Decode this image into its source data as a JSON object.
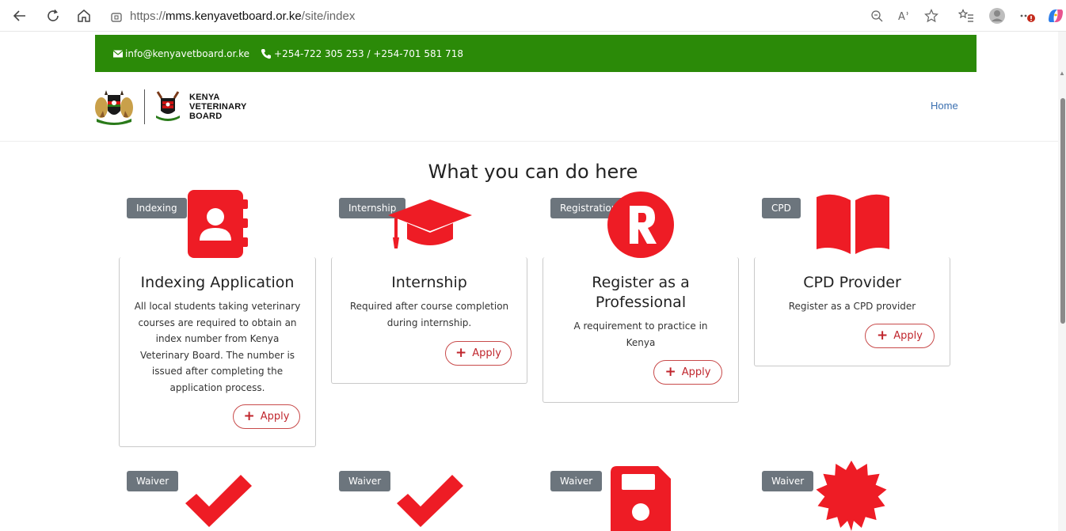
{
  "browser": {
    "url_proto": "https://",
    "url_host": "mms.kenyavetboard.or.ke",
    "url_path": "/site/index"
  },
  "contact": {
    "email": "info@kenyavetboard.or.ke",
    "phone": "+254-722 305 253 / +254-701 581 718"
  },
  "header": {
    "brand_line1": "KENYA",
    "brand_line2": "VETERINARY",
    "brand_line3": "BOARD",
    "nav_home": "Home"
  },
  "main": {
    "heading": "What you can do here",
    "cards": [
      {
        "badge": "Indexing",
        "icon": "address-book-icon",
        "title": "Indexing Application",
        "description": "All local students taking veterinary courses are required to obtain an index number from Kenya Veterinary Board. The number is issued after completing the application process.",
        "button": "Apply"
      },
      {
        "badge": "Internship",
        "icon": "graduation-cap-icon",
        "title": "Internship",
        "description": "Required after course completion during internship.",
        "button": "Apply"
      },
      {
        "badge": "Registration",
        "icon": "registered-r-icon",
        "title": "Register as a Professional",
        "description": "A requirement to practice in Kenya",
        "button": "Apply"
      },
      {
        "badge": "CPD",
        "icon": "book-open-icon",
        "title": "CPD Provider",
        "description": "Register as a CPD provider",
        "button": "Apply"
      }
    ],
    "waivers": [
      {
        "badge": "Waiver",
        "icon": "checkmark-icon"
      },
      {
        "badge": "Waiver",
        "icon": "checkmark-icon"
      },
      {
        "badge": "Waiver",
        "icon": "floppy-disk-icon"
      },
      {
        "badge": "Waiver",
        "icon": "certificate-badge-icon"
      }
    ]
  },
  "colors": {
    "accent_red": "#ee1c25",
    "contact_bar_green": "#2b8a08",
    "badge_gray": "#6c757d",
    "link_blue": "#3a6fb0"
  }
}
